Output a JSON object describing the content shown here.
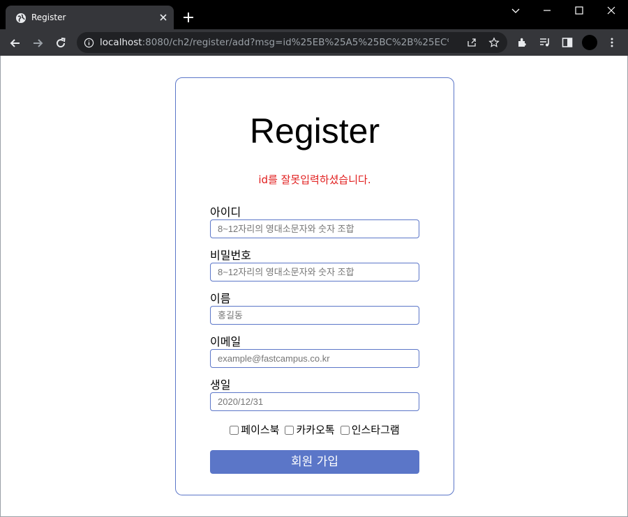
{
  "browser": {
    "tab_title": "Register",
    "url_host": "localhost",
    "url_rest": ":8080/ch2/register/add?msg=id%25EB%25A5%25BC%2B%25EC%259E..."
  },
  "form": {
    "title": "Register",
    "message": "id를 잘못입력하셨습니다.",
    "fields": [
      {
        "label": "아이디",
        "placeholder": "8~12자리의 영대소문자와 숫자 조합",
        "type": "text"
      },
      {
        "label": "비밀번호",
        "placeholder": "8~12자리의 영대소문자와 숫자 조합",
        "type": "password"
      },
      {
        "label": "이름",
        "placeholder": "홍길동",
        "type": "text"
      },
      {
        "label": "이메일",
        "placeholder": "example@fastcampus.co.kr",
        "type": "text"
      },
      {
        "label": "생일",
        "placeholder": "2020/12/31",
        "type": "text"
      }
    ],
    "sns": [
      {
        "label": "페이스북",
        "checked": false
      },
      {
        "label": "카카오톡",
        "checked": false
      },
      {
        "label": "인스타그램",
        "checked": false
      }
    ],
    "submit_label": "회원 가입"
  },
  "colors": {
    "accent": "#5b76c8",
    "error": "#e11d1d",
    "chrome_dark": "#35363a",
    "omnibox": "#202124"
  }
}
